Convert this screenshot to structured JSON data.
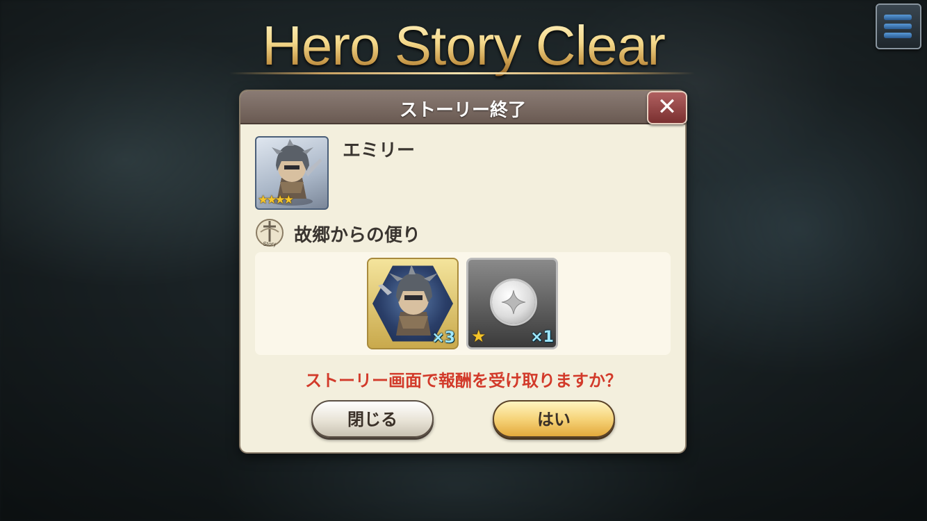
{
  "header": {
    "title": "Hero Story Clear"
  },
  "dialog": {
    "title": "ストーリー終了",
    "close_symbol": "✕",
    "hero": {
      "name": "エミリー",
      "rarity_stars": "★★★★",
      "portrait_icon": "hero-portrait"
    },
    "story": {
      "icon": "story-icon",
      "icon_label": "Story",
      "title": "故郷からの便り"
    },
    "rewards": [
      {
        "icon": "hero-reward-icon",
        "quantity": "×3"
      },
      {
        "icon": "silver-coin-icon",
        "rarity": "★",
        "quantity": "×1"
      }
    ],
    "question": "ストーリー画面で報酬を受け取りますか？",
    "buttons": {
      "close_label": "閉じる",
      "yes_label": "はい"
    }
  },
  "colors": {
    "title_gold": "#f4d88a",
    "dialog_bg": "#f3efdd",
    "question_red": "#d23a2a",
    "yes_button": "#f6d47a"
  }
}
